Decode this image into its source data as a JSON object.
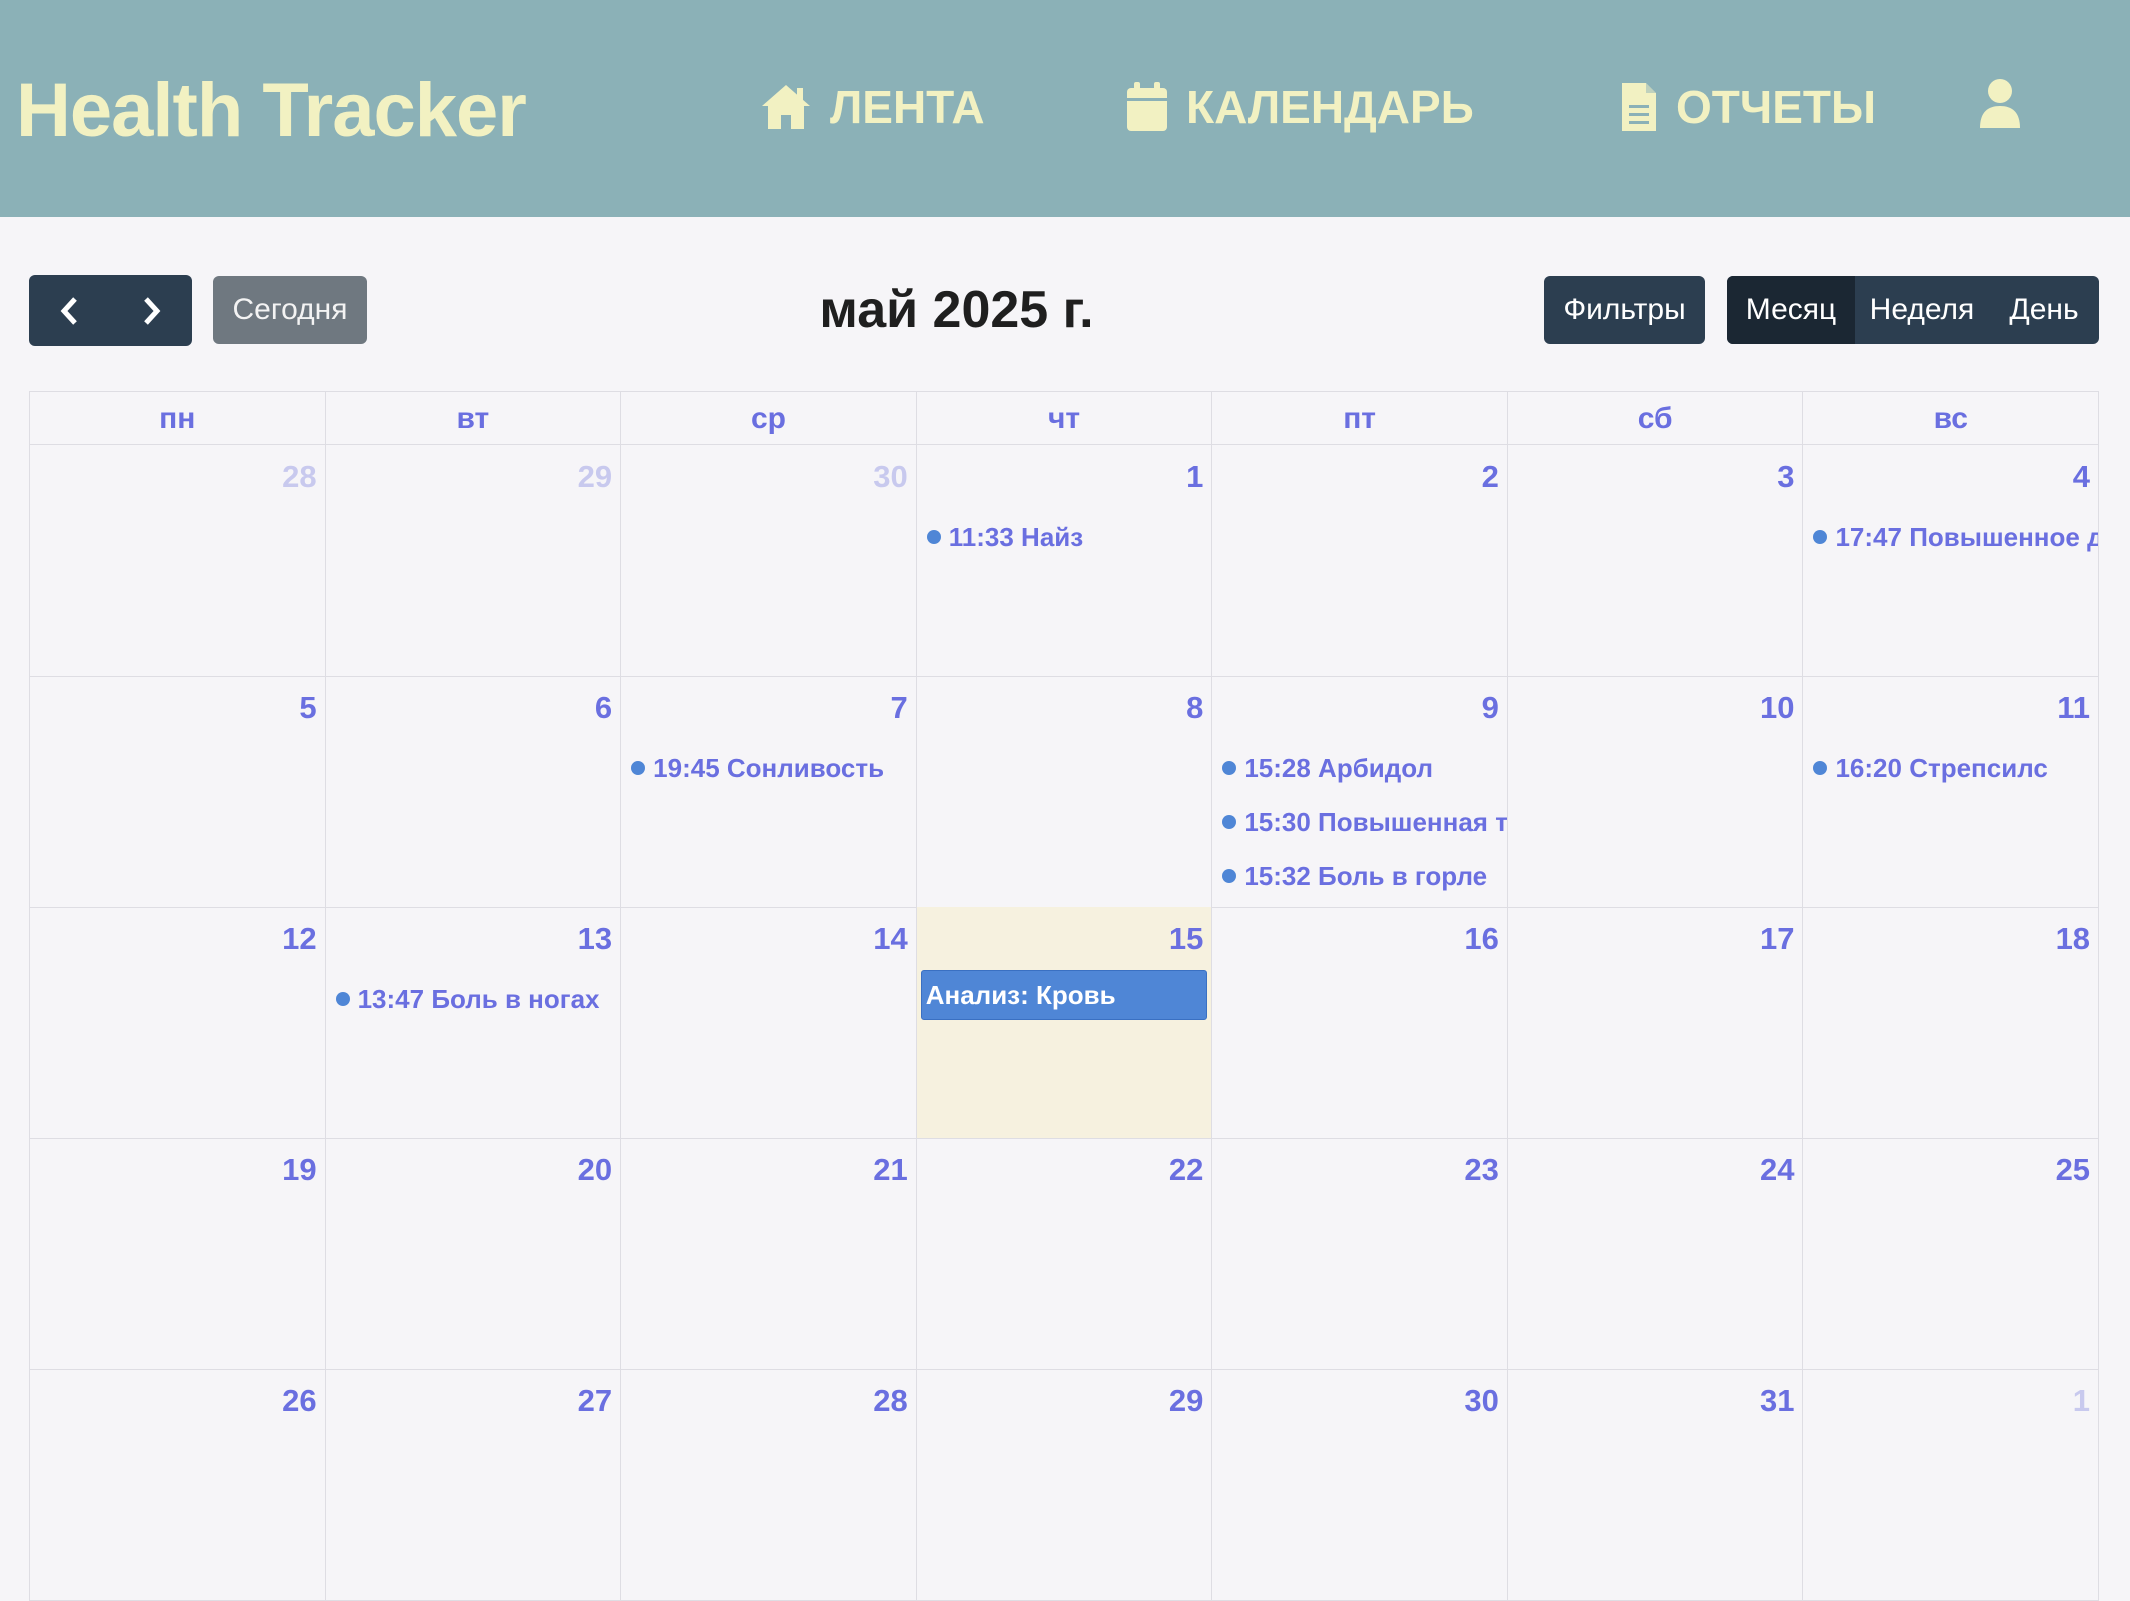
{
  "app": {
    "title": "Health Tracker"
  },
  "nav": {
    "feed": "ЛЕНТА",
    "calendar": "КАЛЕНДАРЬ",
    "reports": "ОТЧЕТЫ"
  },
  "toolbar": {
    "today": "Сегодня",
    "title": "май 2025 г.",
    "filters": "Фильтры",
    "views": [
      "Месяц",
      "Неделя",
      "День"
    ],
    "active_view": "Месяц"
  },
  "weekdays": [
    "пн",
    "вт",
    "ср",
    "чт",
    "пт",
    "сб",
    "вс"
  ],
  "weeks": [
    [
      {
        "day": "28",
        "other": true,
        "events": []
      },
      {
        "day": "29",
        "other": true,
        "events": []
      },
      {
        "day": "30",
        "other": true,
        "events": []
      },
      {
        "day": "1",
        "events": [
          {
            "time": "11:33",
            "title": "Найз"
          }
        ]
      },
      {
        "day": "2",
        "events": []
      },
      {
        "day": "3",
        "events": []
      },
      {
        "day": "4",
        "events": [
          {
            "time": "17:47",
            "title": "Повышенное д"
          }
        ]
      }
    ],
    [
      {
        "day": "5",
        "events": []
      },
      {
        "day": "6",
        "events": []
      },
      {
        "day": "7",
        "events": [
          {
            "time": "19:45",
            "title": "Сонливость"
          }
        ]
      },
      {
        "day": "8",
        "events": []
      },
      {
        "day": "9",
        "events": [
          {
            "time": "15:28",
            "title": "Арбидол"
          },
          {
            "time": "15:30",
            "title": "Повышенная т"
          },
          {
            "time": "15:32",
            "title": "Боль в горле"
          }
        ]
      },
      {
        "day": "10",
        "events": []
      },
      {
        "day": "11",
        "events": [
          {
            "time": "16:20",
            "title": "Стрепсилс"
          }
        ]
      }
    ],
    [
      {
        "day": "12",
        "events": []
      },
      {
        "day": "13",
        "events": [
          {
            "time": "13:47",
            "title": "Боль в ногах"
          }
        ]
      },
      {
        "day": "14",
        "events": []
      },
      {
        "day": "15",
        "today": true,
        "events": [],
        "blocks": [
          {
            "title": "Анализ: Кровь"
          }
        ]
      },
      {
        "day": "16",
        "events": []
      },
      {
        "day": "17",
        "events": []
      },
      {
        "day": "18",
        "events": []
      }
    ],
    [
      {
        "day": "19",
        "events": []
      },
      {
        "day": "20",
        "events": []
      },
      {
        "day": "21",
        "events": []
      },
      {
        "day": "22",
        "events": []
      },
      {
        "day": "23",
        "events": []
      },
      {
        "day": "24",
        "events": []
      },
      {
        "day": "25",
        "events": []
      }
    ],
    [
      {
        "day": "26",
        "events": []
      },
      {
        "day": "27",
        "events": []
      },
      {
        "day": "28",
        "events": []
      },
      {
        "day": "29",
        "events": []
      },
      {
        "day": "30",
        "events": []
      },
      {
        "day": "31",
        "events": []
      },
      {
        "day": "1",
        "other": true,
        "events": []
      }
    ]
  ],
  "colors": {
    "header_bg": "#8bb1b7",
    "header_text": "#f2f1c2",
    "accent": "#6a6fe0",
    "event_blue": "#4f86d6",
    "today_bg": "#f6f1df",
    "button_dark": "#2c3e50"
  }
}
